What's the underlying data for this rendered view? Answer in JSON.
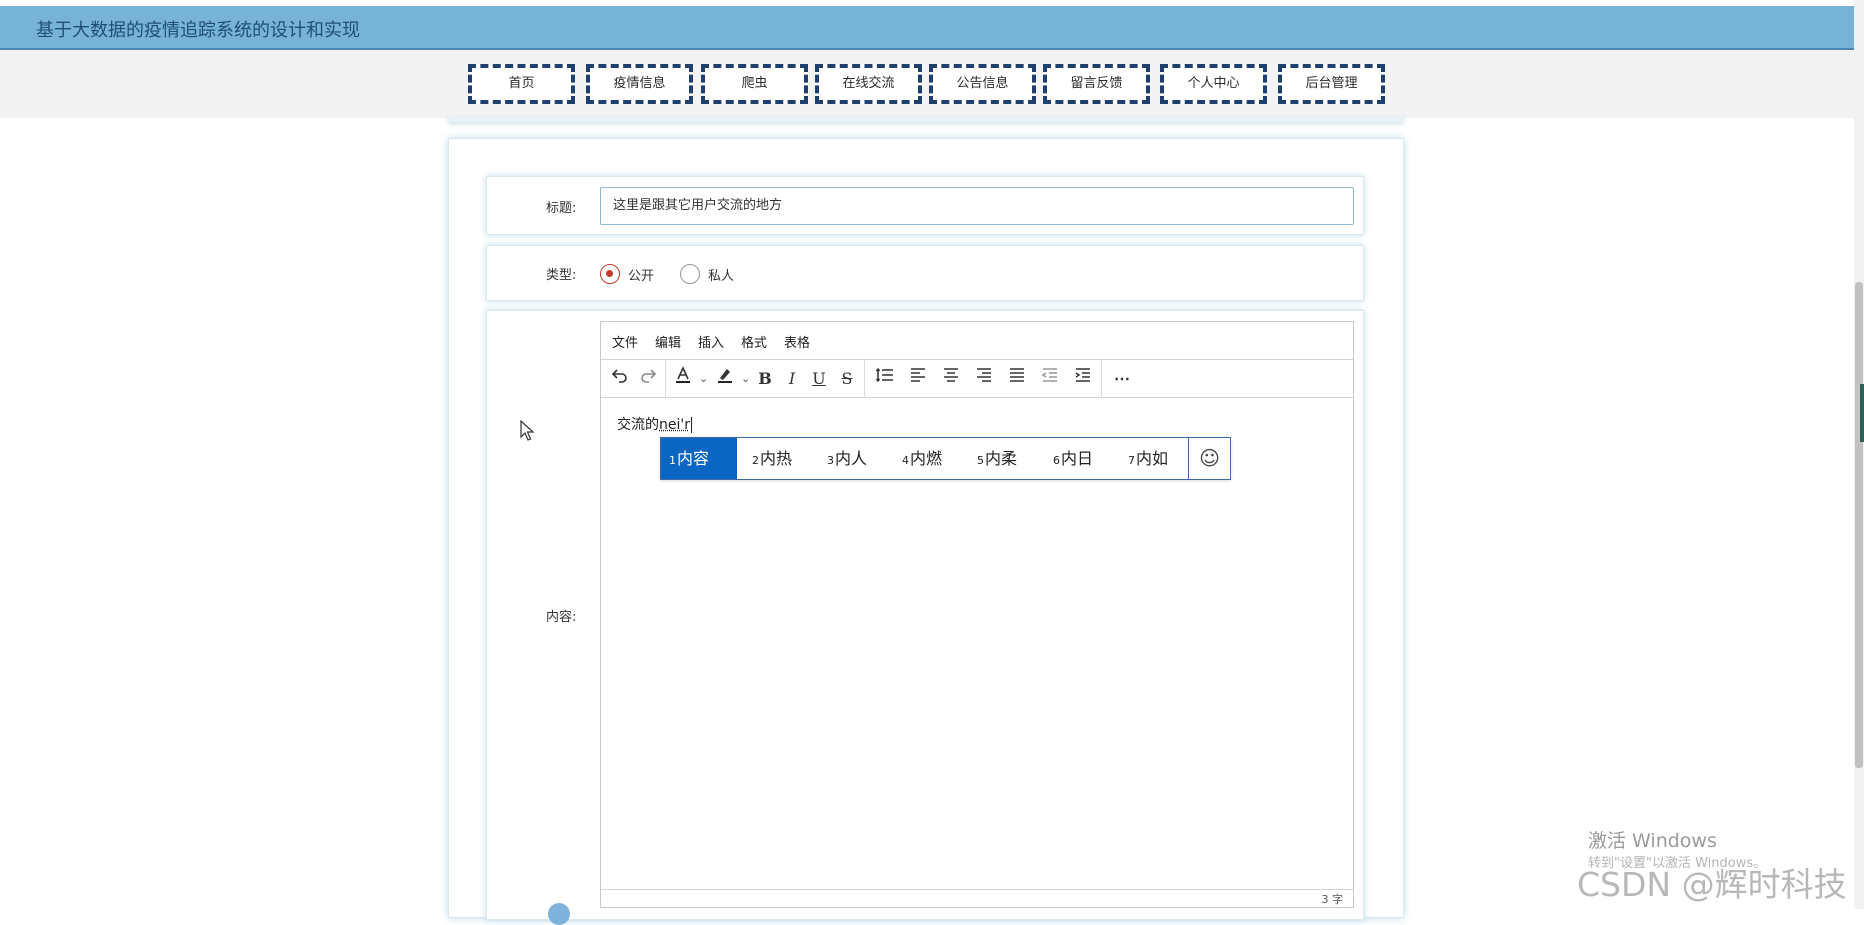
{
  "header": {
    "title": "基于大数据的疫情追踪系统的设计和实现"
  },
  "nav": [
    {
      "label": "首页"
    },
    {
      "label": "疫情信息"
    },
    {
      "label": "爬虫"
    },
    {
      "label": "在线交流"
    },
    {
      "label": "公告信息"
    },
    {
      "label": "留言反馈"
    },
    {
      "label": "个人中心"
    },
    {
      "label": "后台管理"
    }
  ],
  "form": {
    "title_label": "标题:",
    "title_value": "这里是跟其它用户交流的地方",
    "type_label": "类型:",
    "type_options": [
      {
        "label": "公开",
        "checked": true
      },
      {
        "label": "私人",
        "checked": false
      }
    ],
    "content_label": "内容:"
  },
  "editor": {
    "menu": [
      "文件",
      "编辑",
      "插入",
      "格式",
      "表格"
    ],
    "toolbar_icons": [
      "undo-icon",
      "redo-icon",
      "text-color-icon",
      "highlight-color-icon",
      "bold-icon",
      "italic-icon",
      "underline-icon",
      "strikethrough-icon",
      "line-height-icon",
      "align-left-icon",
      "align-center-icon",
      "align-right-icon",
      "align-justify-icon",
      "outdent-icon",
      "indent-icon",
      "more-icon"
    ],
    "content_text": "交流的",
    "composing_text": "nei'r",
    "word_count": "3 字"
  },
  "ime": {
    "candidates": [
      {
        "num": "1",
        "text": "内容",
        "selected": true
      },
      {
        "num": "2",
        "text": "内热"
      },
      {
        "num": "3",
        "text": "内人"
      },
      {
        "num": "4",
        "text": "内燃"
      },
      {
        "num": "5",
        "text": "内柔"
      },
      {
        "num": "6",
        "text": "内日"
      },
      {
        "num": "7",
        "text": "内如"
      }
    ],
    "emoji_glyph": "☺"
  },
  "watermark": {
    "activate_line1": "激活 Windows",
    "activate_line2": "转到\"设置\"以激活 Windows。",
    "csdn": "CSDN @辉时科技"
  },
  "colors": {
    "header_bg": "#76b3d7",
    "nav_border": "#1f3f6e",
    "radio_checked": "#c0392b",
    "ime_selected": "#0b65c2"
  }
}
